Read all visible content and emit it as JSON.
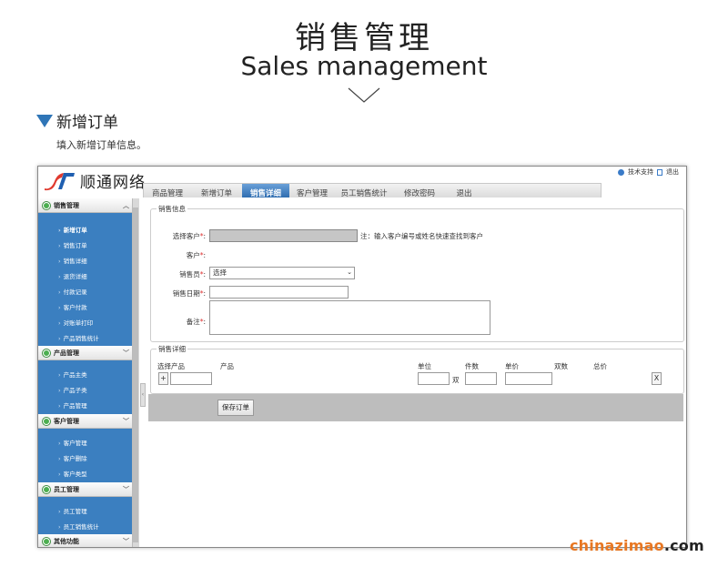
{
  "header": {
    "title": "销售管理",
    "subtitle": "Sales management"
  },
  "section": {
    "title": "新增订单",
    "description": "填入新增订单信息。"
  },
  "app": {
    "logo_text": "顺通网络",
    "top_links": [
      "技术支持",
      "退出"
    ],
    "tabs": [
      {
        "label": "商品管理",
        "active": false
      },
      {
        "label": "新增订单",
        "active": false
      },
      {
        "label": "销售详细",
        "active": true
      },
      {
        "label": "客户管理",
        "active": false
      },
      {
        "label": "员工销售统计",
        "active": false
      },
      {
        "label": "修改密码",
        "active": false
      },
      {
        "label": "退出",
        "active": false
      }
    ],
    "sidebar": {
      "groups": [
        {
          "label": "销售管理",
          "items": [
            "新增订单",
            "销售订单",
            "销售详细",
            "退货详细",
            "付款记录",
            "客户付款",
            "对账单打印",
            "产品销售统计"
          ]
        },
        {
          "label": "产品管理",
          "items": [
            "产品主类",
            "产品子类",
            "产品管理"
          ]
        },
        {
          "label": "客户管理",
          "items": [
            "客户管理",
            "客户删除",
            "客户类型"
          ]
        },
        {
          "label": "员工管理",
          "items": [
            "员工管理",
            "员工销售统计"
          ]
        },
        {
          "label": "其他功能",
          "items": []
        }
      ]
    },
    "sales_info": {
      "legend": "销售信息",
      "customer_select_label": "选择客户",
      "customer_select_note": "注：输入客户编号或姓名快速查找到客户",
      "customer_label": "客户",
      "salesperson_label": "销售员",
      "salesperson_value": "选择",
      "date_label": "销售日期",
      "remark_label": "备注",
      "required_mark": "*",
      "colon": ":"
    },
    "sales_detail": {
      "legend": "销售详细",
      "columns": [
        "选择产品",
        "产品",
        "单位",
        "件数",
        "单价",
        "双数",
        "总价"
      ],
      "add_button": "+",
      "unit_suffix": "双",
      "remove_button": "X"
    },
    "save_button": "保存订单"
  },
  "watermark": {
    "text_a": "chinazimao",
    "text_b": ".com"
  },
  "colors": {
    "accent": "#2f75b7",
    "sidebar": "#3b7fc0",
    "tab_active": "#2f6db0",
    "watermark": "#e87722"
  }
}
